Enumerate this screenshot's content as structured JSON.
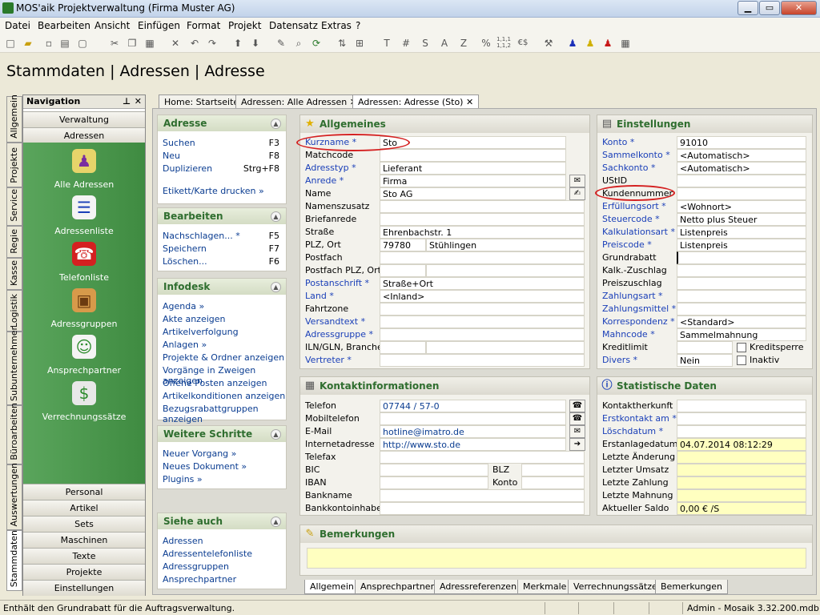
{
  "window": {
    "title": "MOS'aik Projektverwaltung (Firma Muster AG)",
    "btn_min": "▁",
    "btn_max": "▭",
    "btn_close": "✕"
  },
  "menu": [
    "Datei",
    "Bearbeiten",
    "Ansicht",
    "Einfügen",
    "Format",
    "Projekt",
    "Datensatz",
    "Extras",
    "?"
  ],
  "toolbar": {
    "glyphs": [
      "T",
      "#",
      "S",
      "A",
      "Z",
      "%",
      "1,1,1\n1,1,2",
      "€$"
    ]
  },
  "page_title": "Stammdaten | Adressen | Adresse",
  "side_tabs": [
    "Allgemein",
    "Projekte",
    "Service",
    "Regie",
    "Kasse",
    "Logistik",
    "Subunternehmer",
    "Büroarbeiten",
    "Auswertungen",
    "Stammdaten"
  ],
  "nav": {
    "title": "Navigation",
    "pin": "⊥",
    "close": "✕",
    "top": [
      "Verwaltung",
      "Adressen"
    ],
    "items": [
      {
        "label": "Alle Adressen",
        "icon": "people-icon"
      },
      {
        "label": "Adressenliste",
        "icon": "address-list-icon"
      },
      {
        "label": "Telefonliste",
        "icon": "phonebook-icon"
      },
      {
        "label": "Adressgruppen",
        "icon": "box-icon"
      },
      {
        "label": "Ansprechpartner",
        "icon": "contact-card-icon"
      },
      {
        "label": "Verrechnungssätze",
        "icon": "money-bag-icon"
      }
    ],
    "bottom": [
      "Personal",
      "Artikel",
      "Sets",
      "Maschinen",
      "Texte",
      "Projekte",
      "Einstellungen"
    ]
  },
  "doc_tabs": [
    {
      "label": "Home: Startseite",
      "close": ""
    },
    {
      "label": "Adressen: Alle Adressen",
      "close": "✕"
    },
    {
      "label": "Adressen: Adresse (Sto)",
      "close": "✕"
    }
  ],
  "tasks": {
    "adresse": {
      "title": "Adresse",
      "items": [
        {
          "label": "Suchen",
          "key": "F3"
        },
        {
          "label": "Neu",
          "key": "F8"
        },
        {
          "label": "Duplizieren",
          "key": "Strg+F8"
        },
        {
          "label": "Etikett/Karte drucken »",
          "key": ""
        }
      ]
    },
    "bearbeiten": {
      "title": "Bearbeiten",
      "items": [
        {
          "label": "Nachschlagen... *",
          "key": "F5"
        },
        {
          "label": "Speichern",
          "key": "F7"
        },
        {
          "label": "Löschen...",
          "key": "F6"
        }
      ]
    },
    "infodesk": {
      "title": "Infodesk",
      "items": [
        "Agenda »",
        "Akte anzeigen",
        "Artikelverfolgung",
        "Anlagen »",
        "Projekte & Ordner anzeigen",
        "Vorgänge in Zweigen anzeigen",
        "Offene Posten anzeigen",
        "Artikelkonditionen anzeigen",
        "Bezugsrabattgruppen anzeigen"
      ]
    },
    "weitere": {
      "title": "Weitere Schritte",
      "items": [
        "Neuer Vorgang »",
        "Neues Dokument »",
        "Plugins »"
      ]
    },
    "siehe": {
      "title": "Siehe auch",
      "items": [
        "Adressen",
        "Adressentelefonliste",
        "Adressgruppen",
        "Ansprechpartner"
      ]
    }
  },
  "allgemeines": {
    "title": "Allgemeines",
    "rows": [
      {
        "label": "Kurzname *",
        "value": "Sto",
        "link": true
      },
      {
        "label": "Matchcode",
        "value": "",
        "link": false
      },
      {
        "label": "Adresstyp *",
        "value": "Lieferant",
        "link": true
      },
      {
        "label": "Anrede *",
        "value": "Firma",
        "link": true
      },
      {
        "label": "Name",
        "value": "Sto AG",
        "link": false
      },
      {
        "label": "Namenszusatz",
        "value": "",
        "link": false
      },
      {
        "label": "Briefanrede",
        "value": "",
        "link": false
      },
      {
        "label": "Straße",
        "value": "Ehrenbachstr. 1",
        "link": false
      },
      {
        "label": "PLZ, Ort",
        "value": "79780",
        "value2": "Stühlingen",
        "link": false
      },
      {
        "label": "Postfach",
        "value": "",
        "link": false
      },
      {
        "label": "Postfach PLZ, Ort",
        "value": "",
        "value2": "",
        "link": false
      },
      {
        "label": "Postanschrift *",
        "value": "Straße+Ort",
        "link": true
      },
      {
        "label": "Land *",
        "value": "<Inland>",
        "link": true
      },
      {
        "label": "Fahrtzone",
        "value": "",
        "link": false
      },
      {
        "label": "Versandtext *",
        "value": "",
        "link": true
      },
      {
        "label": "Adressgruppe *",
        "value": "",
        "link": true
      },
      {
        "label": "ILN/GLN, Branche",
        "value": "",
        "value2": "",
        "link": false
      },
      {
        "label": "Vertreter *",
        "value": "",
        "link": true
      }
    ]
  },
  "einstellungen": {
    "title": "Einstellungen",
    "rows": [
      {
        "label": "Konto *",
        "value": "91010",
        "link": true
      },
      {
        "label": "Sammelkonto *",
        "value": "<Automatisch>",
        "link": true
      },
      {
        "label": "Sachkonto *",
        "value": "<Automatisch>",
        "link": true
      },
      {
        "label": "UStID",
        "value": "",
        "link": false
      },
      {
        "label": "Kundennummer",
        "value": "",
        "link": false
      },
      {
        "label": "Erfüllungsort *",
        "value": "<Wohnort>",
        "link": true
      },
      {
        "label": "Steuercode *",
        "value": "Netto plus Steuer",
        "link": true
      },
      {
        "label": "Kalkulationsart *",
        "value": "Listenpreis",
        "link": true
      },
      {
        "label": "Preiscode *",
        "value": "Listenpreis",
        "link": true
      },
      {
        "label": "Grundrabatt",
        "value": "",
        "link": false
      },
      {
        "label": "Kalk.-Zuschlag",
        "value": "",
        "link": false
      },
      {
        "label": "Preiszuschlag",
        "value": "",
        "link": false
      },
      {
        "label": "Zahlungsart *",
        "value": "",
        "link": true
      },
      {
        "label": "Zahlungsmittel *",
        "value": "",
        "link": true
      },
      {
        "label": "Korrespondenz *",
        "value": "<Standard>",
        "link": true
      },
      {
        "label": "Mahncode *",
        "value": "Sammelmahnung",
        "link": true
      },
      {
        "label": "Kreditlimit",
        "value": "",
        "link": false,
        "check": "Kreditsperre"
      },
      {
        "label": "Divers *",
        "value": "Nein",
        "link": true,
        "check": "Inaktiv"
      }
    ]
  },
  "kontakt": {
    "title": "Kontaktinformationen",
    "rows": [
      {
        "label": "Telefon",
        "value": "07744 / 57-0",
        "btn": "☎"
      },
      {
        "label": "Mobiltelefon",
        "value": "",
        "btn": "☎"
      },
      {
        "label": "E-Mail",
        "value": "hotline@imatro.de",
        "btn": "✉"
      },
      {
        "label": "Internetadresse",
        "value": "http://www.sto.de",
        "btn": "➔"
      },
      {
        "label": "Telefax",
        "value": "",
        "btn": ""
      },
      {
        "label": "BIC",
        "value": "",
        "label2": "BLZ",
        "value2": ""
      },
      {
        "label": "IBAN",
        "value": "",
        "label2": "Konto",
        "value2": ""
      },
      {
        "label": "Bankname",
        "value": ""
      },
      {
        "label": "Bankkontoinhaber",
        "value": ""
      }
    ]
  },
  "statistik": {
    "title": "Statistische Daten",
    "rows": [
      {
        "label": "Kontaktherkunft",
        "value": "",
        "link": false
      },
      {
        "label": "Erstkontakt am *",
        "value": "",
        "link": true
      },
      {
        "label": "Löschdatum *",
        "value": "",
        "link": true
      },
      {
        "label": "Erstanlagedatum",
        "value": "04.07.2014 08:12:29",
        "link": false
      },
      {
        "label": "Letzte Änderung",
        "value": "",
        "link": false
      },
      {
        "label": "Letzter Umsatz",
        "value": "",
        "link": false
      },
      {
        "label": "Letzte Zahlung",
        "value": "",
        "link": false
      },
      {
        "label": "Letzte Mahnung",
        "value": "",
        "link": false
      },
      {
        "label": "Aktueller Saldo",
        "value": "0,00 € /S",
        "link": false
      }
    ]
  },
  "bemerkungen": {
    "title": "Bemerkungen",
    "value": ""
  },
  "bottom_tabs": [
    "Allgemein",
    "Ansprechpartner",
    "Adressreferenzen",
    "Merkmale",
    "Verrechnungssätze",
    "Bemerkungen"
  ],
  "status": {
    "text": "Enthält den Grundrabatt für die Auftragsverwaltung.",
    "user": "Admin - Mosaik 3.32.200.mdb"
  },
  "colors": {
    "link": "#1a3fb8",
    "nav_green": "#4a984c",
    "annotation": "#d42020",
    "readonly_yellow": "#ffffc0"
  }
}
